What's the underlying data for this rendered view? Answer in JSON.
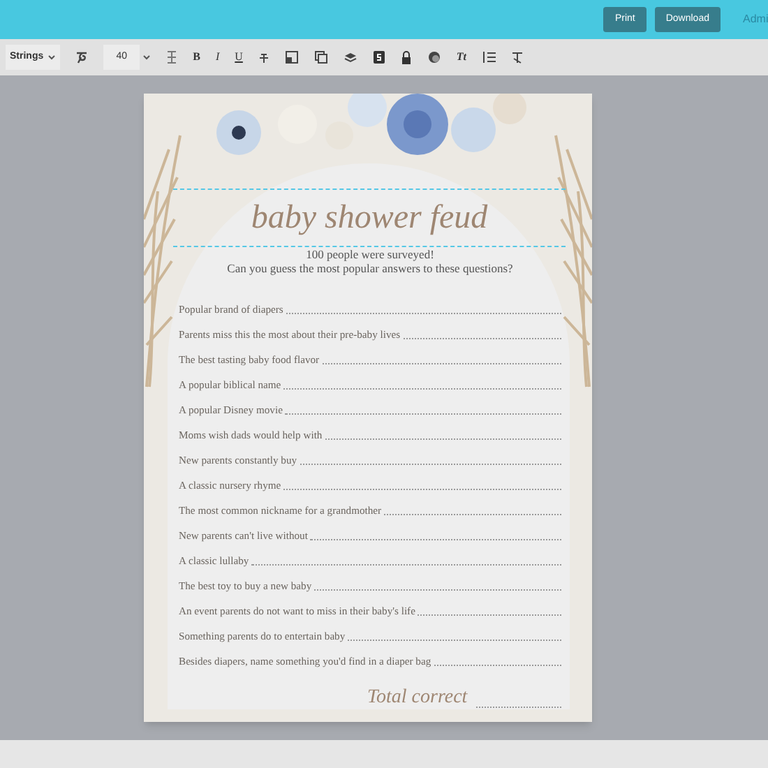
{
  "header": {
    "buttons": [
      {
        "label": "Print"
      },
      {
        "label": "Download"
      }
    ],
    "user_link": "Admi"
  },
  "toolbar": {
    "font_dropdown": "Strings",
    "font_size": "40",
    "bold": "B",
    "italic": "I",
    "underline": "U",
    "text_size": "Tt"
  },
  "document": {
    "title": "baby shower feud",
    "subtitle": [
      "100 people were surveyed!",
      "Can you guess the most popular answers to these questions?"
    ],
    "questions": [
      "Popular brand of diapers",
      "Parents miss this the most about their pre-baby lives",
      "The best tasting baby food flavor",
      "A popular biblical name",
      "A popular Disney movie",
      "Moms wish dads would help with",
      "New parents constantly buy",
      "A classic nursery rhyme",
      "The most common nickname for a grandmother",
      "New parents can't live without",
      "A classic lullaby",
      "The best toy to buy a new baby",
      "An event parents do not want to miss in their baby's life",
      "Something parents do to entertain baby",
      "Besides diapers, name something you'd find in a diaper bag"
    ],
    "footer": "Total correct"
  }
}
